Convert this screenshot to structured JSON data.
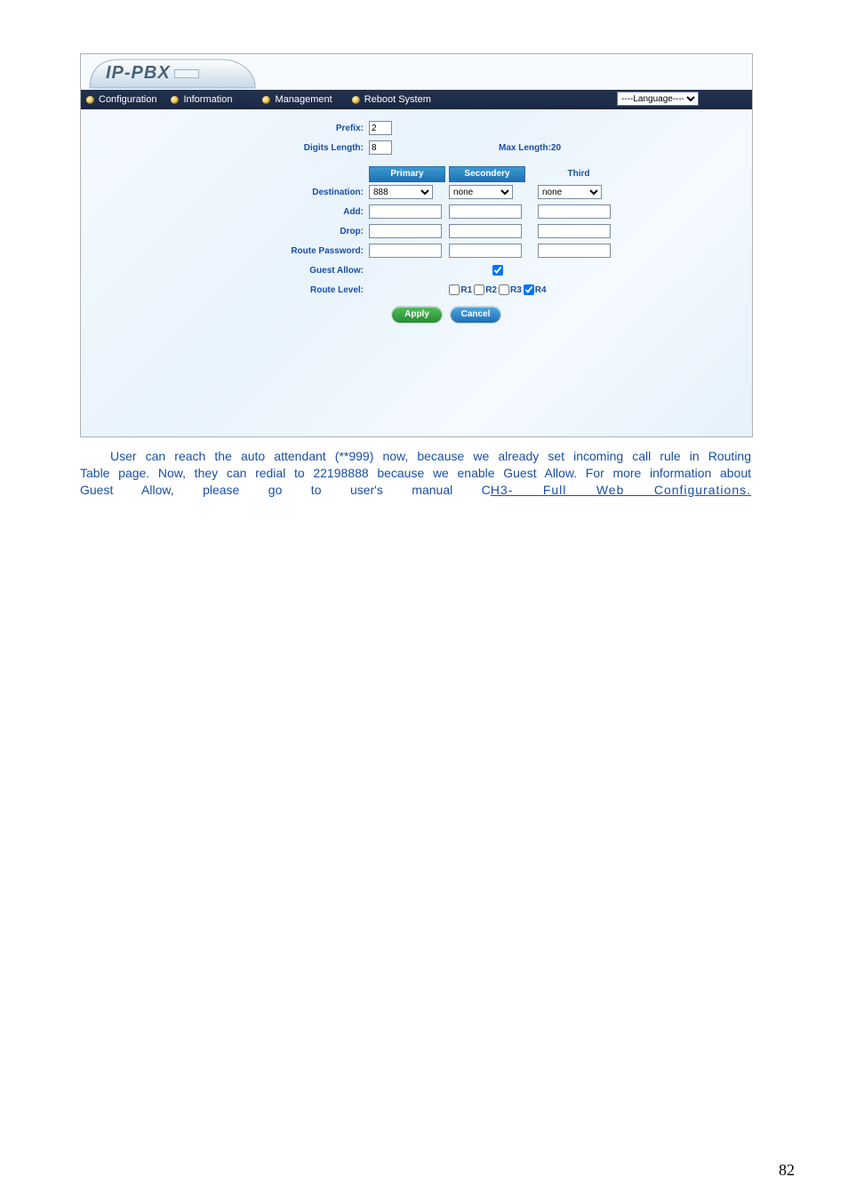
{
  "brand": "IP-PBX",
  "menu": {
    "configuration": "Configuration",
    "information": "Information",
    "management": "Management",
    "reboot": "Reboot System",
    "language_placeholder": "----Language----"
  },
  "form": {
    "prefix_label": "Prefix:",
    "prefix_value": "2",
    "digits_length_label": "Digits Length:",
    "digits_length_value": "8",
    "max_length_label": "Max Length:20",
    "headers": {
      "primary": "Primary",
      "secondary": "Secondery",
      "third": "Third"
    },
    "rows": {
      "destination": "Destination:",
      "add": "Add:",
      "drop": "Drop:",
      "route_password": "Route Password:",
      "guest_allow": "Guest Allow:",
      "route_level": "Route Level:"
    },
    "destination_primary": "888",
    "none": "none",
    "route_levels": {
      "r1": "R1",
      "r2": "R2",
      "r3": "R3",
      "r4": "R4"
    },
    "buttons": {
      "apply": "Apply",
      "cancel": "Cancel"
    }
  },
  "caption": {
    "line1": "User can reach the auto attendant (**999) now, because we already set incoming call rule in Routing",
    "line2": "Table page. Now, they can redial to 22198888 because we enable Guest Allow. For more information about",
    "line3_a": "Guest   Allow,   please   go   to   user's   manual   C",
    "line3_b": "H3-   Full   Web  Configurations."
  },
  "page_number": "82"
}
